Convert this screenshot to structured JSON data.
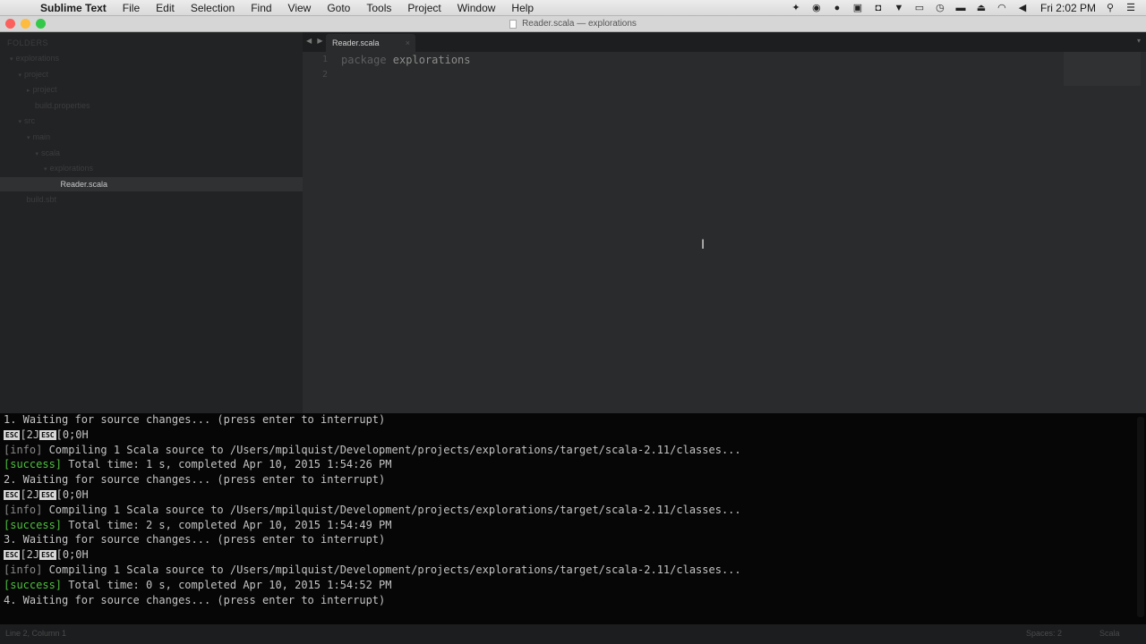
{
  "menubar": {
    "apple": "",
    "items": [
      "Sublime Text",
      "File",
      "Edit",
      "Selection",
      "Find",
      "View",
      "Goto",
      "Tools",
      "Project",
      "Window",
      "Help"
    ],
    "clock": "Fri 2:02 PM"
  },
  "window": {
    "title": "Reader.scala — explorations"
  },
  "sidebar": {
    "folders_label": "FOLDERS",
    "tree": [
      {
        "label": "explorations",
        "indent": 0,
        "arrow": "▾"
      },
      {
        "label": "project",
        "indent": 1,
        "arrow": "▾"
      },
      {
        "label": "project",
        "indent": 2,
        "arrow": "▸"
      },
      {
        "label": "build.properties",
        "indent": 2,
        "arrow": ""
      },
      {
        "label": "src",
        "indent": 1,
        "arrow": "▾"
      },
      {
        "label": "main",
        "indent": 2,
        "arrow": "▾"
      },
      {
        "label": "scala",
        "indent": 3,
        "arrow": "▾"
      },
      {
        "label": "explorations",
        "indent": 4,
        "arrow": "▾"
      },
      {
        "label": "Reader.scala",
        "indent": 5,
        "arrow": "",
        "selected": true
      },
      {
        "label": "build.sbt",
        "indent": 1,
        "arrow": ""
      }
    ]
  },
  "editor": {
    "tab_label": "Reader.scala",
    "tab_close": "×",
    "line_numbers": [
      "1",
      "2"
    ],
    "lines": [
      {
        "keyword": "package",
        "text": " explorations"
      },
      {
        "keyword": "",
        "text": ""
      }
    ]
  },
  "terminal": {
    "lines": [
      {
        "type": "plain",
        "text": "1. Waiting for source changes... (press enter to interrupt)"
      },
      {
        "type": "esc",
        "esc": "ESC",
        "a": "[2J",
        "b": "[0;0H"
      },
      {
        "type": "tag",
        "tag": "[info]",
        "tag_class": "info",
        "text": " Compiling 1 Scala source to /Users/mpilquist/Development/projects/explorations/target/scala-2.11/classes..."
      },
      {
        "type": "tag",
        "tag": "[success]",
        "tag_class": "success",
        "text": " Total time: 1 s, completed Apr 10, 2015 1:54:26 PM"
      },
      {
        "type": "plain",
        "text": "2. Waiting for source changes... (press enter to interrupt)"
      },
      {
        "type": "esc",
        "esc": "ESC",
        "a": "[2J",
        "b": "[0;0H"
      },
      {
        "type": "tag",
        "tag": "[info]",
        "tag_class": "info",
        "text": " Compiling 1 Scala source to /Users/mpilquist/Development/projects/explorations/target/scala-2.11/classes..."
      },
      {
        "type": "tag",
        "tag": "[success]",
        "tag_class": "success",
        "text": " Total time: 2 s, completed Apr 10, 2015 1:54:49 PM"
      },
      {
        "type": "plain",
        "text": "3. Waiting for source changes... (press enter to interrupt)"
      },
      {
        "type": "esc",
        "esc": "ESC",
        "a": "[2J",
        "b": "[0;0H"
      },
      {
        "type": "tag",
        "tag": "[info]",
        "tag_class": "info",
        "text": " Compiling 1 Scala source to /Users/mpilquist/Development/projects/explorations/target/scala-2.11/classes..."
      },
      {
        "type": "tag",
        "tag": "[success]",
        "tag_class": "success",
        "text": " Total time: 0 s, completed Apr 10, 2015 1:54:52 PM"
      },
      {
        "type": "plain",
        "text": "4. Waiting for source changes... (press enter to interrupt)"
      }
    ]
  },
  "statusbar": {
    "position": "Line 2, Column 1",
    "tab_size": "Spaces: 2",
    "syntax": "Scala"
  },
  "colors": {
    "success": "#4fbf3f",
    "editor_bg": "#2a2b2c",
    "terminal_bg": "#060606",
    "sidebar_bg": "#222324"
  }
}
